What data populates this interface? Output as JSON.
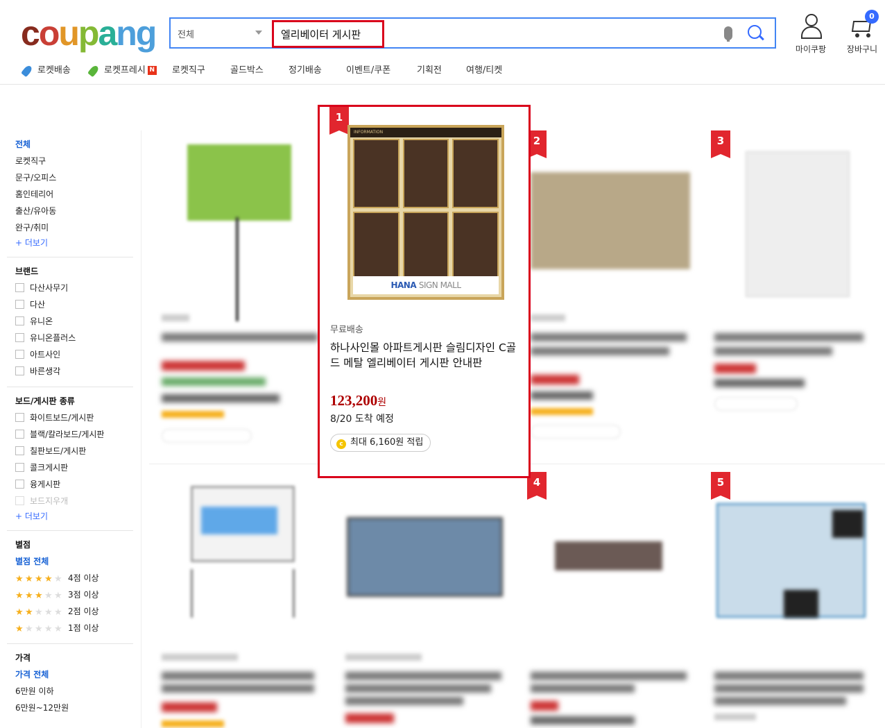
{
  "header": {
    "logo": "coupang",
    "search": {
      "category": "전체",
      "query": "엘리베이터 게시판"
    },
    "mypage_label": "마이쿠팡",
    "cart_label": "장바구니",
    "cart_count": "0"
  },
  "nav": {
    "items": [
      "로켓배송",
      "로켓프레시",
      "로켓직구",
      "골드박스",
      "정기배송",
      "이벤트/쿠폰",
      "기획전",
      "여행/티켓"
    ]
  },
  "sidebar": {
    "categories": [
      "전체",
      "로켓직구",
      "문구/오피스",
      "홈인테리어",
      "출산/유아동",
      "완구/취미"
    ],
    "more1": "+ 더보기",
    "brand_title": "브랜드",
    "brands": [
      "다산사무기",
      "다산",
      "유니온",
      "유니온플러스",
      "아트사인",
      "바른생각"
    ],
    "board_title": "보드/게시판 종류",
    "boards": [
      "화이트보드/게시판",
      "블랙/칼라보드/게시판",
      "칠판보드/게시판",
      "콜크게시판",
      "융게시판",
      "보드지우개"
    ],
    "more2": "+ 더보기",
    "rating_title": "별점",
    "rating_all": "별점 전체",
    "ratings": [
      "4점 이상",
      "3점 이상",
      "2점 이상",
      "1점 이상"
    ],
    "price_title": "가격",
    "price_all": "가격 전체",
    "prices": [
      "6만원 이하",
      "6만원~12만원"
    ]
  },
  "products": {
    "ranks": [
      "1",
      "2",
      "3",
      "4",
      "5"
    ],
    "featured": {
      "shipping": "무료배송",
      "title": "하나사인몰 아파트게시판 슬림디자인 C골드 메탈 엘리베이터 게시판 안내판",
      "price": "123,200",
      "price_unit": "원",
      "arrival": "8/20 도착 예정",
      "reward": "최대 6,160원 적립",
      "image_header": "INFORMATION",
      "image_brand_bold": "HANA",
      "image_brand_thin": "SIGN MALL"
    }
  },
  "colors": {
    "accent": "#346aff",
    "highlight": "#d9001b",
    "price": "#ae0000",
    "logo_c": "#872b1e",
    "logo_o": "#c93f36",
    "logo_u": "#e19627",
    "logo_p": "#84b935",
    "logo_a": "#2aaf97",
    "logo_n": "#4d9fdb",
    "logo_g": "#4d9fdb"
  }
}
